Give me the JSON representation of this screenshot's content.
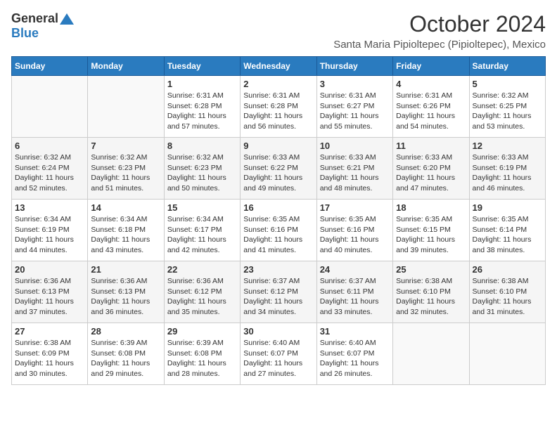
{
  "logo": {
    "general": "General",
    "blue": "Blue"
  },
  "title": "October 2024",
  "location": "Santa Maria Pipioltepec (Pipioltepec), Mexico",
  "days_of_week": [
    "Sunday",
    "Monday",
    "Tuesday",
    "Wednesday",
    "Thursday",
    "Friday",
    "Saturday"
  ],
  "weeks": [
    [
      {
        "day": "",
        "sunrise": "",
        "sunset": "",
        "daylight": ""
      },
      {
        "day": "",
        "sunrise": "",
        "sunset": "",
        "daylight": ""
      },
      {
        "day": "1",
        "sunrise": "Sunrise: 6:31 AM",
        "sunset": "Sunset: 6:28 PM",
        "daylight": "Daylight: 11 hours and 57 minutes."
      },
      {
        "day": "2",
        "sunrise": "Sunrise: 6:31 AM",
        "sunset": "Sunset: 6:28 PM",
        "daylight": "Daylight: 11 hours and 56 minutes."
      },
      {
        "day": "3",
        "sunrise": "Sunrise: 6:31 AM",
        "sunset": "Sunset: 6:27 PM",
        "daylight": "Daylight: 11 hours and 55 minutes."
      },
      {
        "day": "4",
        "sunrise": "Sunrise: 6:31 AM",
        "sunset": "Sunset: 6:26 PM",
        "daylight": "Daylight: 11 hours and 54 minutes."
      },
      {
        "day": "5",
        "sunrise": "Sunrise: 6:32 AM",
        "sunset": "Sunset: 6:25 PM",
        "daylight": "Daylight: 11 hours and 53 minutes."
      }
    ],
    [
      {
        "day": "6",
        "sunrise": "Sunrise: 6:32 AM",
        "sunset": "Sunset: 6:24 PM",
        "daylight": "Daylight: 11 hours and 52 minutes."
      },
      {
        "day": "7",
        "sunrise": "Sunrise: 6:32 AM",
        "sunset": "Sunset: 6:23 PM",
        "daylight": "Daylight: 11 hours and 51 minutes."
      },
      {
        "day": "8",
        "sunrise": "Sunrise: 6:32 AM",
        "sunset": "Sunset: 6:23 PM",
        "daylight": "Daylight: 11 hours and 50 minutes."
      },
      {
        "day": "9",
        "sunrise": "Sunrise: 6:33 AM",
        "sunset": "Sunset: 6:22 PM",
        "daylight": "Daylight: 11 hours and 49 minutes."
      },
      {
        "day": "10",
        "sunrise": "Sunrise: 6:33 AM",
        "sunset": "Sunset: 6:21 PM",
        "daylight": "Daylight: 11 hours and 48 minutes."
      },
      {
        "day": "11",
        "sunrise": "Sunrise: 6:33 AM",
        "sunset": "Sunset: 6:20 PM",
        "daylight": "Daylight: 11 hours and 47 minutes."
      },
      {
        "day": "12",
        "sunrise": "Sunrise: 6:33 AM",
        "sunset": "Sunset: 6:19 PM",
        "daylight": "Daylight: 11 hours and 46 minutes."
      }
    ],
    [
      {
        "day": "13",
        "sunrise": "Sunrise: 6:34 AM",
        "sunset": "Sunset: 6:19 PM",
        "daylight": "Daylight: 11 hours and 44 minutes."
      },
      {
        "day": "14",
        "sunrise": "Sunrise: 6:34 AM",
        "sunset": "Sunset: 6:18 PM",
        "daylight": "Daylight: 11 hours and 43 minutes."
      },
      {
        "day": "15",
        "sunrise": "Sunrise: 6:34 AM",
        "sunset": "Sunset: 6:17 PM",
        "daylight": "Daylight: 11 hours and 42 minutes."
      },
      {
        "day": "16",
        "sunrise": "Sunrise: 6:35 AM",
        "sunset": "Sunset: 6:16 PM",
        "daylight": "Daylight: 11 hours and 41 minutes."
      },
      {
        "day": "17",
        "sunrise": "Sunrise: 6:35 AM",
        "sunset": "Sunset: 6:16 PM",
        "daylight": "Daylight: 11 hours and 40 minutes."
      },
      {
        "day": "18",
        "sunrise": "Sunrise: 6:35 AM",
        "sunset": "Sunset: 6:15 PM",
        "daylight": "Daylight: 11 hours and 39 minutes."
      },
      {
        "day": "19",
        "sunrise": "Sunrise: 6:35 AM",
        "sunset": "Sunset: 6:14 PM",
        "daylight": "Daylight: 11 hours and 38 minutes."
      }
    ],
    [
      {
        "day": "20",
        "sunrise": "Sunrise: 6:36 AM",
        "sunset": "Sunset: 6:13 PM",
        "daylight": "Daylight: 11 hours and 37 minutes."
      },
      {
        "day": "21",
        "sunrise": "Sunrise: 6:36 AM",
        "sunset": "Sunset: 6:13 PM",
        "daylight": "Daylight: 11 hours and 36 minutes."
      },
      {
        "day": "22",
        "sunrise": "Sunrise: 6:36 AM",
        "sunset": "Sunset: 6:12 PM",
        "daylight": "Daylight: 11 hours and 35 minutes."
      },
      {
        "day": "23",
        "sunrise": "Sunrise: 6:37 AM",
        "sunset": "Sunset: 6:12 PM",
        "daylight": "Daylight: 11 hours and 34 minutes."
      },
      {
        "day": "24",
        "sunrise": "Sunrise: 6:37 AM",
        "sunset": "Sunset: 6:11 PM",
        "daylight": "Daylight: 11 hours and 33 minutes."
      },
      {
        "day": "25",
        "sunrise": "Sunrise: 6:38 AM",
        "sunset": "Sunset: 6:10 PM",
        "daylight": "Daylight: 11 hours and 32 minutes."
      },
      {
        "day": "26",
        "sunrise": "Sunrise: 6:38 AM",
        "sunset": "Sunset: 6:10 PM",
        "daylight": "Daylight: 11 hours and 31 minutes."
      }
    ],
    [
      {
        "day": "27",
        "sunrise": "Sunrise: 6:38 AM",
        "sunset": "Sunset: 6:09 PM",
        "daylight": "Daylight: 11 hours and 30 minutes."
      },
      {
        "day": "28",
        "sunrise": "Sunrise: 6:39 AM",
        "sunset": "Sunset: 6:08 PM",
        "daylight": "Daylight: 11 hours and 29 minutes."
      },
      {
        "day": "29",
        "sunrise": "Sunrise: 6:39 AM",
        "sunset": "Sunset: 6:08 PM",
        "daylight": "Daylight: 11 hours and 28 minutes."
      },
      {
        "day": "30",
        "sunrise": "Sunrise: 6:40 AM",
        "sunset": "Sunset: 6:07 PM",
        "daylight": "Daylight: 11 hours and 27 minutes."
      },
      {
        "day": "31",
        "sunrise": "Sunrise: 6:40 AM",
        "sunset": "Sunset: 6:07 PM",
        "daylight": "Daylight: 11 hours and 26 minutes."
      },
      {
        "day": "",
        "sunrise": "",
        "sunset": "",
        "daylight": ""
      },
      {
        "day": "",
        "sunrise": "",
        "sunset": "",
        "daylight": ""
      }
    ]
  ]
}
